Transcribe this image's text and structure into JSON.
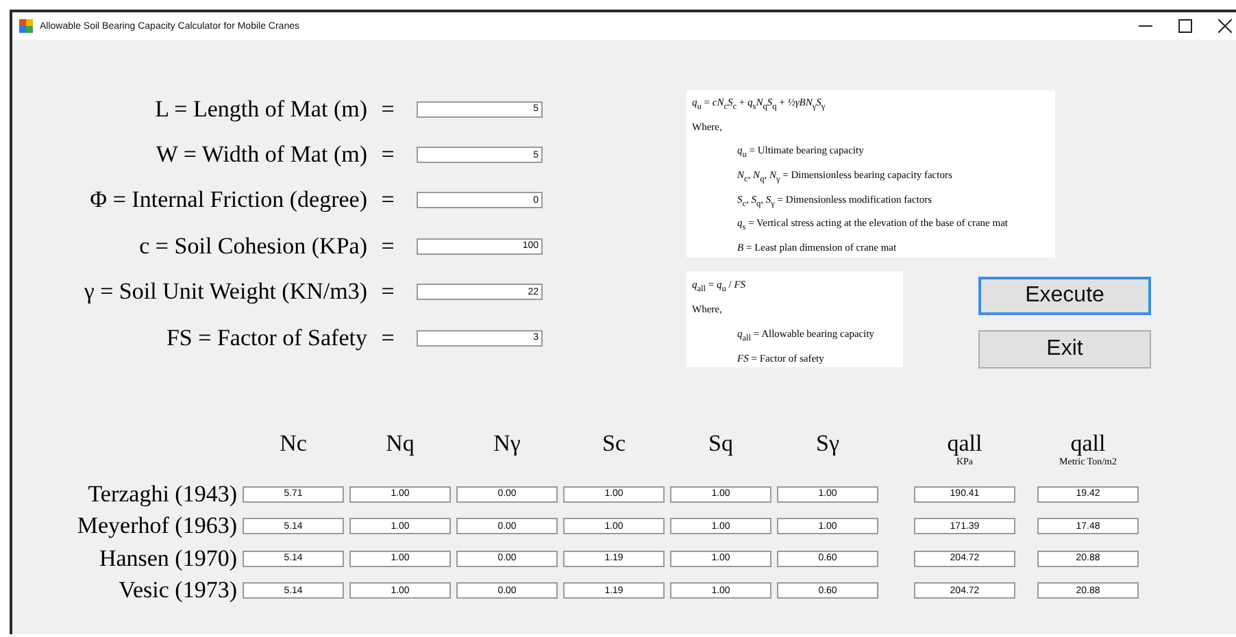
{
  "window": {
    "title": "Allowable Soil Bearing Capacity Calculator for Mobile Cranes"
  },
  "inputs": [
    {
      "label": "L = Length of Mat (m)",
      "equals": "=",
      "value": "5"
    },
    {
      "label": "W = Width of Mat (m)",
      "equals": "=",
      "value": "5"
    },
    {
      "label": "Φ = Internal Friction (degree)",
      "equals": "=",
      "value": "0"
    },
    {
      "label": "c = Soil Cohesion (KPa)",
      "equals": "=",
      "value": "100"
    },
    {
      "label": "γ = Soil Unit Weight (KN/m3)",
      "equals": "=",
      "value": "22"
    },
    {
      "label": "FS = Factor of Safety",
      "equals": "=",
      "value": "3"
    }
  ],
  "formula_panels": [
    {
      "equation": "*q*$_{u}$ = *cN*$_{c}$*S*$_{c}$ + *q*$_{s}$*N*$_{q}$*S*$_{q}$ + *½γBN*$_{γ}$*S*$_{γ}$",
      "where": "Where,",
      "definitions": [
        "*q*$_{u}$ = Ultimate bearing capacity",
        "*N*$_{c}$, *N*$_{q}$, *N*$_{γ}$ = Dimensionless bearing capacity factors",
        "*S*$_{c}$, *S*$_{q}$, *S*$_{γ}$ = Dimensionless modification factors",
        "*q*$_{s}$ = Vertical stress acting at the elevation of the base of crane mat",
        "*B* = Least plan dimension of crane mat"
      ]
    },
    {
      "equation": "*q*$_{all}$ = *q*$_{u}$ / *FS*",
      "where": "Where,",
      "definitions": [
        "*q*$_{all}$ = Allowable bearing capacity",
        "*FS* = Factor of safety"
      ]
    }
  ],
  "buttons": [
    {
      "label": "Execute",
      "focused": true
    },
    {
      "label": "Exit",
      "focused": false
    }
  ],
  "table": {
    "columns": [
      {
        "label": "Nc"
      },
      {
        "label": "Nq"
      },
      {
        "label": "Nγ"
      },
      {
        "label": "Sc"
      },
      {
        "label": "Sq"
      },
      {
        "label": "Sγ"
      },
      {
        "label": "qall",
        "unit": "KPa"
      },
      {
        "label": "qall",
        "unit": "Metric Ton/m2"
      }
    ],
    "rows": [
      {
        "name": "Terzaghi (1943)",
        "values": [
          "5.71",
          "1.00",
          "0.00",
          "1.00",
          "1.00",
          "1.00",
          "190.41",
          "19.42"
        ]
      },
      {
        "name": "Meyerhof (1963)",
        "values": [
          "5.14",
          "1.00",
          "0.00",
          "1.00",
          "1.00",
          "1.00",
          "171.39",
          "17.48"
        ]
      },
      {
        "name": "Hansen (1970)",
        "values": [
          "5.14",
          "1.00",
          "0.00",
          "1.19",
          "1.00",
          "0.60",
          "204.72",
          "20.88"
        ]
      },
      {
        "name": "Vesic (1973)",
        "values": [
          "5.14",
          "1.00",
          "0.00",
          "1.19",
          "1.00",
          "0.60",
          "204.72",
          "20.88"
        ]
      }
    ]
  }
}
